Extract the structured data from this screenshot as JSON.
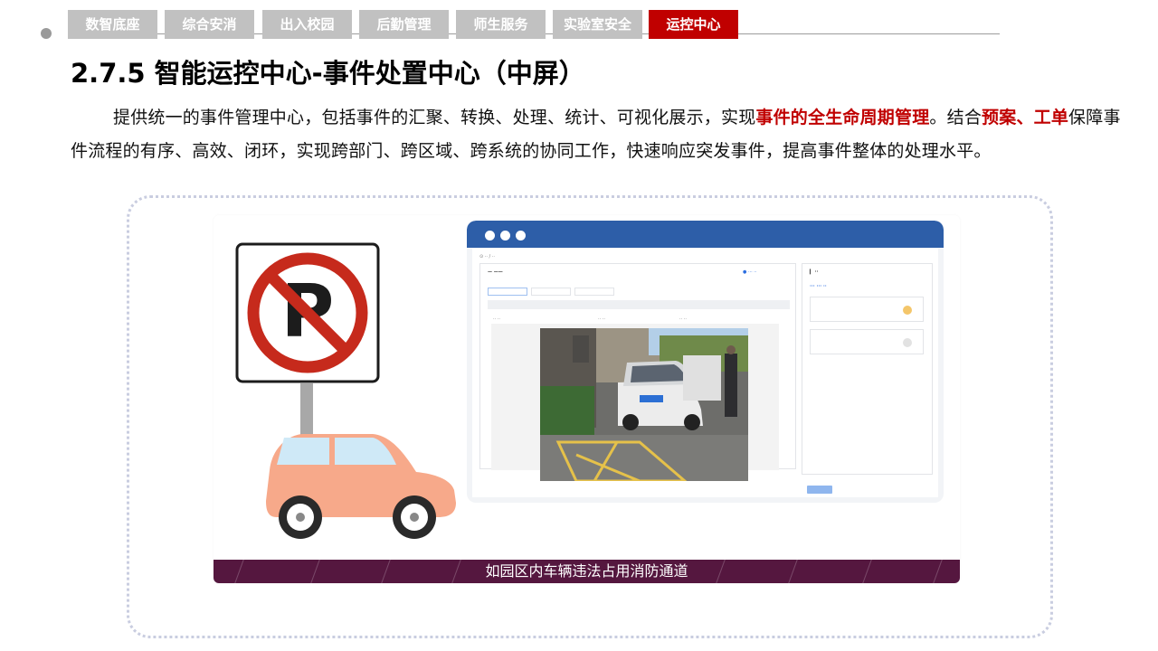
{
  "tabs": [
    {
      "label": "数智底座",
      "active": false
    },
    {
      "label": "综合安消",
      "active": false
    },
    {
      "label": "出入校园",
      "active": false
    },
    {
      "label": "后勤管理",
      "active": false
    },
    {
      "label": "师生服务",
      "active": false
    },
    {
      "label": "实验室安全",
      "active": false
    },
    {
      "label": "运控中心",
      "active": true
    }
  ],
  "title": "2.7.5 智能运控中心-事件处置中心（中屏）",
  "intro": {
    "p1": "提供统一的事件管理中心，包括事件的汇聚、转换、处理、统计、可视化展示，实现",
    "h1": "事件的全生命周期管理",
    "p2": "。结合",
    "h2": "预案、工单",
    "p3": "保障事件流程的有序、高效、闭环，实现跨部门、跨区域、跨系统的协同工作，快速响应突发事件，提高事件整体的处理水平。"
  },
  "video": {
    "caption": "如园区内车辆违法占用消防通道"
  },
  "colors": {
    "accent": "#c00000",
    "tab_inactive": "#c1c1c1",
    "caption_bg": "#55173f",
    "browser_header": "#2d5ea8"
  }
}
